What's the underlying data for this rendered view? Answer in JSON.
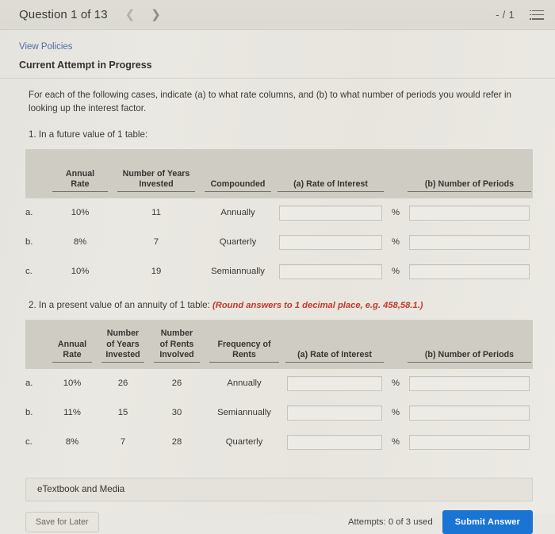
{
  "header": {
    "question_label": "Question 1 of 13",
    "prev_icon": "chevron-left-icon",
    "next_icon": "chevron-right-icon",
    "score": "- / 1",
    "menu_icon": "list-menu-icon"
  },
  "links": {
    "view_policies": "View Policies"
  },
  "status": {
    "attempt_status": "Current Attempt in Progress"
  },
  "prompt": {
    "text": "For each of the following cases, indicate (a) to what rate columns, and (b) to what number of periods you would refer in looking up the interest factor."
  },
  "section1": {
    "label": "1. In a future value of 1 table:",
    "headers": {
      "letter": "",
      "annual_rate": "Annual\nRate",
      "annual_rate_l1": "Annual",
      "annual_rate_l2": "Rate",
      "years_l1": "Number of Years",
      "years_l2": "Invested",
      "compounded": "Compounded",
      "rate_of_interest": "(a) Rate of Interest",
      "number_of_periods": "(b) Number of Periods"
    },
    "rows": [
      {
        "letter": "a.",
        "annual_rate": "10%",
        "years_invested": "11",
        "compounded": "Annually",
        "rate_of_interest": "",
        "number_of_periods": "",
        "percent": "%"
      },
      {
        "letter": "b.",
        "annual_rate": "8%",
        "years_invested": "7",
        "compounded": "Quarterly",
        "rate_of_interest": "",
        "number_of_periods": "",
        "percent": "%"
      },
      {
        "letter": "c.",
        "annual_rate": "10%",
        "years_invested": "19",
        "compounded": "Semiannually",
        "rate_of_interest": "",
        "number_of_periods": "",
        "percent": "%"
      }
    ]
  },
  "section2": {
    "label": "2. In a present value of an annuity of 1 table:",
    "note": "(Round answers to 1 decimal place, e.g. 458,58.1.)",
    "headers": {
      "annual_rate_l1": "Annual",
      "annual_rate_l2": "Rate",
      "years_l1": "Number",
      "years_l2": "of Years",
      "years_l3": "Invested",
      "rents_l1": "Number",
      "rents_l2": "of Rents",
      "rents_l3": "Involved",
      "frequency_l1": "Frequency of",
      "frequency_l2": "Rents",
      "rate_of_interest": "(a) Rate of Interest",
      "number_of_periods": "(b) Number of Periods"
    },
    "rows": [
      {
        "letter": "a.",
        "annual_rate": "10%",
        "years_invested": "26",
        "rents_involved": "26",
        "frequency": "Annually",
        "rate_of_interest": "",
        "number_of_periods": "",
        "percent": "%"
      },
      {
        "letter": "b.",
        "annual_rate": "11%",
        "years_invested": "15",
        "rents_involved": "30",
        "frequency": "Semiannually",
        "rate_of_interest": "",
        "number_of_periods": "",
        "percent": "%"
      },
      {
        "letter": "c.",
        "annual_rate": "8%",
        "years_invested": "7",
        "rents_involved": "28",
        "frequency": "Quarterly",
        "rate_of_interest": "",
        "number_of_periods": "",
        "percent": "%"
      }
    ]
  },
  "etextbook": {
    "label": "eTextbook and Media"
  },
  "footer": {
    "save_label": "Save for Later",
    "attempts": "Attempts: 0 of 3 used",
    "submit_label": "Submit Answer"
  },
  "colors": {
    "accent_blue": "#1a74d4",
    "link_blue": "#4a6fa8",
    "note_red": "#c0392b",
    "page_bg": "#e9e7e1",
    "table_header_bg": "#cfccc4"
  }
}
